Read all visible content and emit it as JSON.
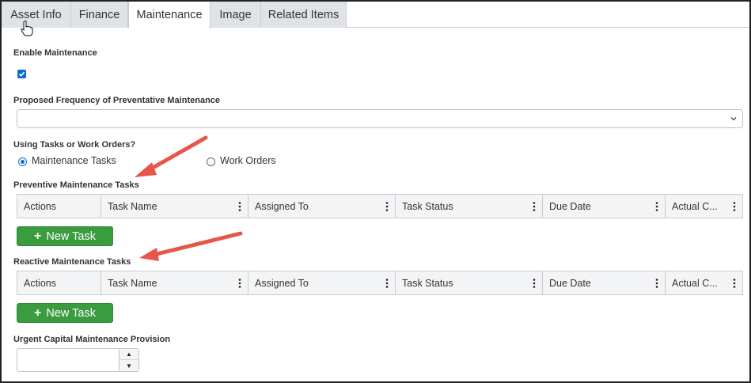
{
  "tabs": [
    {
      "label": "Asset Info"
    },
    {
      "label": "Finance"
    },
    {
      "label": "Maintenance"
    },
    {
      "label": "Image"
    },
    {
      "label": "Related Items"
    }
  ],
  "active_tab": "Maintenance",
  "enable_maintenance": {
    "label": "Enable Maintenance",
    "checked": true
  },
  "frequency": {
    "label": "Proposed Frequency of Preventative Maintenance",
    "value": ""
  },
  "mode": {
    "label": "Using Tasks or Work Orders?",
    "options": [
      {
        "label": "Maintenance Tasks",
        "selected": true
      },
      {
        "label": "Work Orders",
        "selected": false
      }
    ]
  },
  "preventive": {
    "title": "Preventive Maintenance Tasks",
    "columns": [
      "Actions",
      "Task Name",
      "Assigned To",
      "Task Status",
      "Due Date",
      "Actual C..."
    ],
    "new_button": "New Task"
  },
  "reactive": {
    "title": "Reactive Maintenance Tasks",
    "columns": [
      "Actions",
      "Task Name",
      "Assigned To",
      "Task Status",
      "Due Date",
      "Actual C..."
    ],
    "new_button": "New Task"
  },
  "urgent": {
    "label": "Urgent Capital Maintenance Provision",
    "value": ""
  },
  "colors": {
    "accent": "#0b6bd3",
    "button": "#3b9b3f",
    "annotation_arrow": "#e8554a",
    "tab_bg": "#dfe3e7"
  },
  "icons": [
    "hand-cursor-icon",
    "checkmark-icon",
    "chevron-down-icon",
    "kebab-menu-icon",
    "plus-icon",
    "caret-up-icon",
    "caret-down-icon",
    "annotation-arrow-icon"
  ]
}
